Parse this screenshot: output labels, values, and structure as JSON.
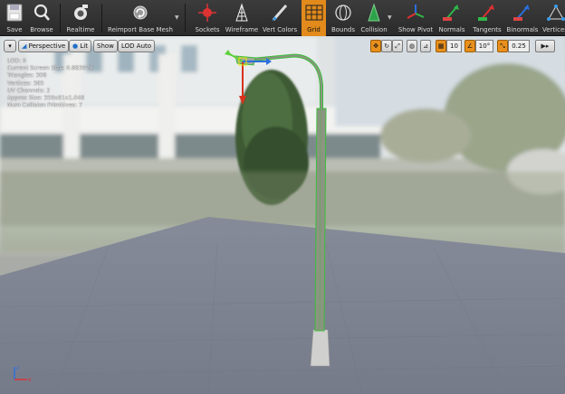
{
  "toolbar": {
    "buttons": [
      {
        "label": "Save",
        "icon": "save-icon"
      },
      {
        "label": "Browse",
        "icon": "browse-icon"
      },
      {
        "label": "Realtime",
        "icon": "realtime-icon"
      },
      {
        "label": "Reimport Base Mesh",
        "icon": "reimport-icon"
      },
      {
        "label": "Sockets",
        "icon": "sockets-icon"
      },
      {
        "label": "Wireframe",
        "icon": "wireframe-icon"
      },
      {
        "label": "Vert Colors",
        "icon": "vert-colors-icon"
      },
      {
        "label": "Grid",
        "icon": "grid-icon",
        "active": true
      },
      {
        "label": "Bounds",
        "icon": "bounds-icon"
      },
      {
        "label": "Collision",
        "icon": "collision-icon"
      },
      {
        "label": "Show Pivot",
        "icon": "show-pivot-icon"
      },
      {
        "label": "Normals",
        "icon": "normals-icon"
      },
      {
        "label": "Tangents",
        "icon": "tangents-icon"
      },
      {
        "label": "Binormals",
        "icon": "binormals-icon"
      },
      {
        "label": "Vertices",
        "icon": "vertices-icon"
      }
    ],
    "accent": "#e28a1b"
  },
  "viewport_toolbar": {
    "perspective": "Perspective",
    "lit": "Lit",
    "show": "Show",
    "lod": "LOD Auto"
  },
  "transform_bar": {
    "grid_snap": "10",
    "rotation_snap": "10°",
    "scale_snap": "0.25"
  },
  "stats": {
    "lod": "LOD:  0",
    "screen_size": "Current Screen Size:  0.883978",
    "triangles": "Triangles:  308",
    "vertices": "Vertices:  385",
    "uv_channels": "UV Channels:  2",
    "approx_size": "Approx Size:  359x61x1,048",
    "collision_primitives": "Num Collision Primitives:  7"
  },
  "axis": {
    "z": "z",
    "x": "x"
  }
}
